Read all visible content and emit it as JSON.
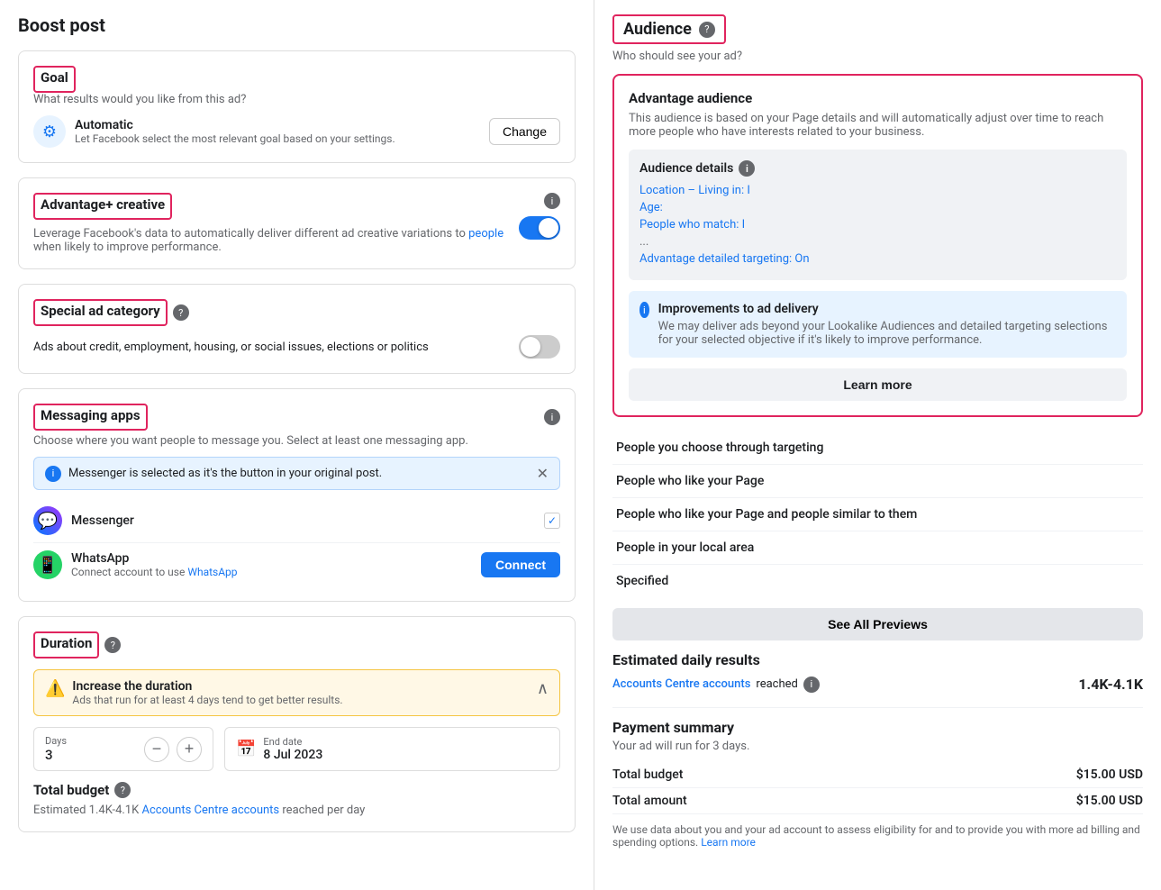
{
  "page": {
    "title": "Boost post"
  },
  "left": {
    "goal": {
      "section_label": "Goal",
      "subtext": "What results would you like from this ad?",
      "auto_label": "Automatic",
      "auto_desc": "Let Facebook select the most relevant goal based on your settings.",
      "change_btn": "Change"
    },
    "advantage_creative": {
      "section_label": "Advantage+ creative",
      "desc_part1": "Leverage Facebook's data to automatically deliver different ad creative variations to",
      "desc_link": "people",
      "desc_part2": "when likely to improve performance."
    },
    "special_ad": {
      "section_label": "Special ad category",
      "toggle_label": "Ads about credit, employment, housing, or social issues, elections or politics"
    },
    "messaging_apps": {
      "section_label": "Messaging apps",
      "subtext": "Choose where you want people to message you. Select at least one messaging app.",
      "banner_text": "Messenger is selected as it's the button in your original post.",
      "messenger_label": "Messenger",
      "whatsapp_label": "WhatsApp",
      "whatsapp_desc_prefix": "Connect account to use",
      "whatsapp_desc_link": "WhatsApp",
      "connect_btn": "Connect"
    },
    "duration": {
      "section_label": "Duration",
      "warn_title": "Increase the duration",
      "warn_desc": "Ads that run for at least 4 days tend to get better results.",
      "days_label": "Days",
      "days_value": "3",
      "end_date_label": "End date",
      "end_date_value": "8 Jul 2023"
    },
    "total_budget": {
      "label": "Total budget",
      "estimated_text": "Estimated 1.4K-4.1K",
      "accounts_link": "Accounts Centre accounts",
      "reached_text": "reached per day"
    }
  },
  "right": {
    "audience": {
      "title": "Audience",
      "who_label": "Who should see your ad?",
      "advantage_audience": {
        "title": "Advantage audience",
        "desc": "This audience is based on your Page details and will automatically adjust over time to reach more people who have interests related to your business.",
        "details_title": "Audience details",
        "location_label": "Location – Living in:",
        "location_value": "I",
        "age_label": "Age:",
        "people_match_label": "People who match:",
        "people_match_value": "I",
        "fade_text": "...",
        "targeting_label": "Advantage detailed targeting:",
        "targeting_value": "On",
        "improvements_title": "Improvements to ad delivery",
        "improvements_desc": "We may deliver ads beyond your Lookalike Audiences and detailed targeting selections for your selected objective if it's likely to improve performance.",
        "learn_more_btn": "Learn more"
      },
      "options": [
        "People you choose through targeting",
        "People who like your Page",
        "People who like your Page and people similar to them",
        "People in your local area",
        "Specified"
      ],
      "see_all_btn": "See All Previews"
    },
    "estimated_results": {
      "title": "Estimated daily results",
      "accounts_label": "Accounts Centre accounts",
      "reached_label": "reached",
      "value": "1.4K-4.1K"
    },
    "payment_summary": {
      "title": "Payment summary",
      "subtitle": "Your ad will run for 3 days.",
      "rows": [
        {
          "label": "Total budget",
          "value": "$15.00 USD"
        },
        {
          "label": "Total amount",
          "value": "$15.00 USD"
        }
      ],
      "footer": "We use data about you and your ad account to assess eligibility for and to provide you with more ad billing and spending options.",
      "footer_link": "Learn more"
    }
  },
  "icons": {
    "info": "ℹ",
    "settings": "⚙",
    "check": "✓",
    "close": "✕",
    "chevron_up": "∧",
    "calendar": "📅",
    "warning": "⚠"
  }
}
